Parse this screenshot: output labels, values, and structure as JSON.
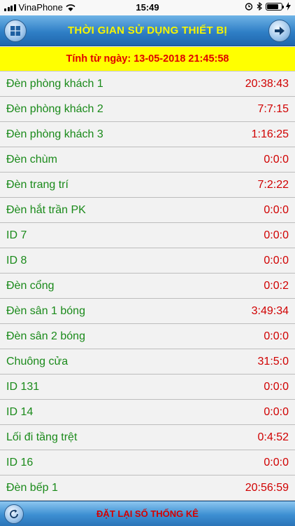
{
  "status_bar": {
    "carrier": "VinaPhone",
    "time": "15:49",
    "icons": [
      "signal-icon",
      "wifi-icon",
      "alarm-icon",
      "bluetooth-icon",
      "battery-icon",
      "charging-icon"
    ]
  },
  "header": {
    "title": "THỜI GIAN SỬ DỤNG THIẾT BỊ",
    "left_icon": "windows-menu-icon",
    "right_icon": "arrow-right-icon"
  },
  "since": {
    "label": "Tính từ ngày: 13-05-2018 21:45:58"
  },
  "devices": [
    {
      "name": "Đèn phòng khách 1",
      "time": "20:38:43"
    },
    {
      "name": "Đèn phòng khách 2",
      "time": "7:7:15"
    },
    {
      "name": "Đèn phòng khách 3",
      "time": "1:16:25"
    },
    {
      "name": "Đèn chùm",
      "time": "0:0:0"
    },
    {
      "name": "Đèn trang trí",
      "time": "7:2:22"
    },
    {
      "name": "Đèn hắt trần PK",
      "time": "0:0:0"
    },
    {
      "name": "ID 7",
      "time": "0:0:0"
    },
    {
      "name": "ID 8",
      "time": "0:0:0"
    },
    {
      "name": "Đèn cổng",
      "time": "0:0:2"
    },
    {
      "name": "Đèn sân 1 bóng",
      "time": "3:49:34"
    },
    {
      "name": "Đèn sân 2 bóng",
      "time": "0:0:0"
    },
    {
      "name": "Chuông cửa",
      "time": "31:5:0"
    },
    {
      "name": "ID 131",
      "time": "0:0:0"
    },
    {
      "name": "ID 14",
      "time": "0:0:0"
    },
    {
      "name": "Lối đi tầng trệt",
      "time": "0:4:52"
    },
    {
      "name": "ID 16",
      "time": "0:0:0"
    },
    {
      "name": "Đèn bếp 1",
      "time": "20:56:59"
    }
  ],
  "footer": {
    "reset_label": "ĐẶT LẠI SỐ THỐNG KÊ",
    "refresh_icon": "refresh-icon"
  },
  "colors": {
    "header_title": "#f7f500",
    "banner_bg": "#ffff00",
    "banner_text": "#e00000",
    "device_name": "#1a8a1a",
    "device_time": "#d00000",
    "reset_text": "#d40000"
  }
}
